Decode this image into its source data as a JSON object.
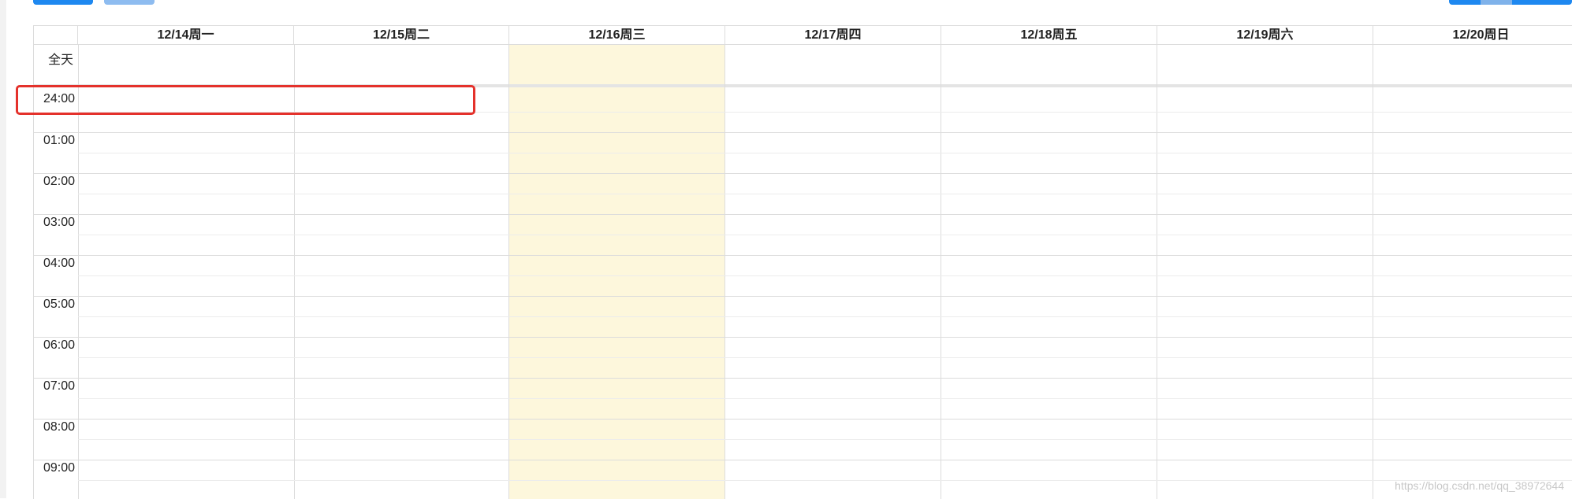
{
  "calendar": {
    "days": [
      {
        "label": "12/14周一"
      },
      {
        "label": "12/15周二"
      },
      {
        "label": "12/16周三",
        "today": true
      },
      {
        "label": "12/17周四"
      },
      {
        "label": "12/18周五"
      },
      {
        "label": "12/19周六"
      },
      {
        "label": "12/20周日"
      }
    ],
    "all_day_label": "全天",
    "hours": [
      "24:00",
      "01:00",
      "02:00",
      "03:00",
      "04:00",
      "05:00",
      "06:00",
      "07:00",
      "08:00",
      "09:00"
    ]
  },
  "colors": {
    "today_highlight": "#fdf7dc",
    "annotation_box": "#e4312b",
    "toolbar_button": "#1e88f0"
  },
  "watermark": "https://blog.csdn.net/qq_38972644"
}
